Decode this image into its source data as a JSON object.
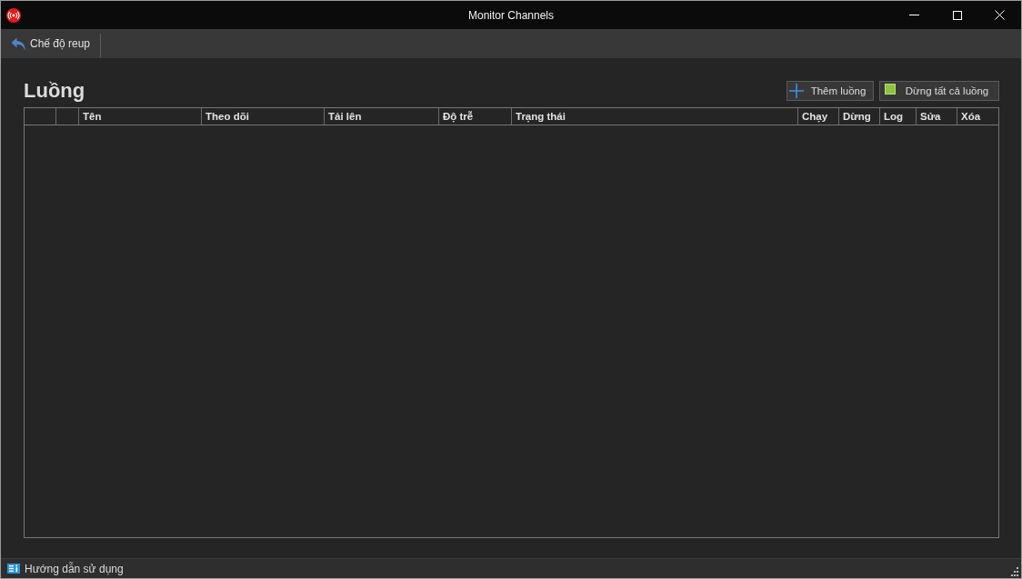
{
  "window": {
    "title": "Monitor Channels"
  },
  "toolbar": {
    "items": [
      {
        "label": "Chế độ reup",
        "kind": "back"
      }
    ]
  },
  "section": {
    "title": "Luồng",
    "buttons": [
      {
        "label": "Thêm luồng",
        "kind": "add"
      },
      {
        "label": "Dừng tất cả luồng",
        "kind": "stop"
      }
    ]
  },
  "table": {
    "columns": [
      {
        "kind": "blank"
      },
      {
        "kind": "blank"
      },
      {
        "kind": "text",
        "label": "Tên"
      },
      {
        "kind": "text",
        "label": "Theo dõi"
      },
      {
        "kind": "text",
        "label": "Tải lên"
      },
      {
        "kind": "text",
        "label": "Độ trễ"
      },
      {
        "kind": "text",
        "label": "Trạng thái"
      },
      {
        "kind": "text",
        "label": "Chạy"
      },
      {
        "kind": "text",
        "label": "Dừng"
      },
      {
        "kind": "text",
        "label": "Log"
      },
      {
        "kind": "text",
        "label": "Sửa"
      },
      {
        "kind": "text",
        "label": "Xóa"
      }
    ]
  },
  "status_bar": {
    "link": "Hướng dẫn sử dụng"
  }
}
